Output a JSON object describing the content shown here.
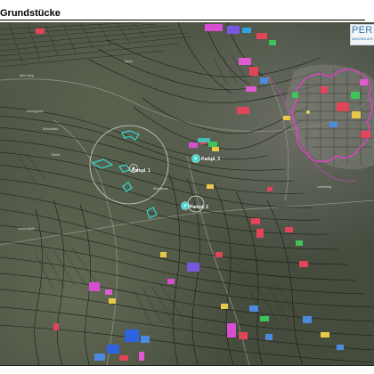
{
  "header": {
    "title": "Grundstücke"
  },
  "logo": {
    "text": "PER",
    "subtext": "IMMOBILIEN"
  },
  "map": {
    "plot_labels": [
      "Parkpl. 1",
      "Parkpl. 2",
      "Parkpl. 3"
    ],
    "place_labels": [
      "Aiche",
      "Alter Weg",
      "Eichelwald",
      "Kellergasse",
      "Riede",
      "Steinbruch",
      "Leiterberg",
      "Hohenwarth"
    ],
    "colors": {
      "terrain": "#4e5646",
      "lines": "#1b1c18",
      "plot_highlight": "#35d7cf",
      "boundary": "#e040c8",
      "circle": "#e6e6e6"
    }
  }
}
